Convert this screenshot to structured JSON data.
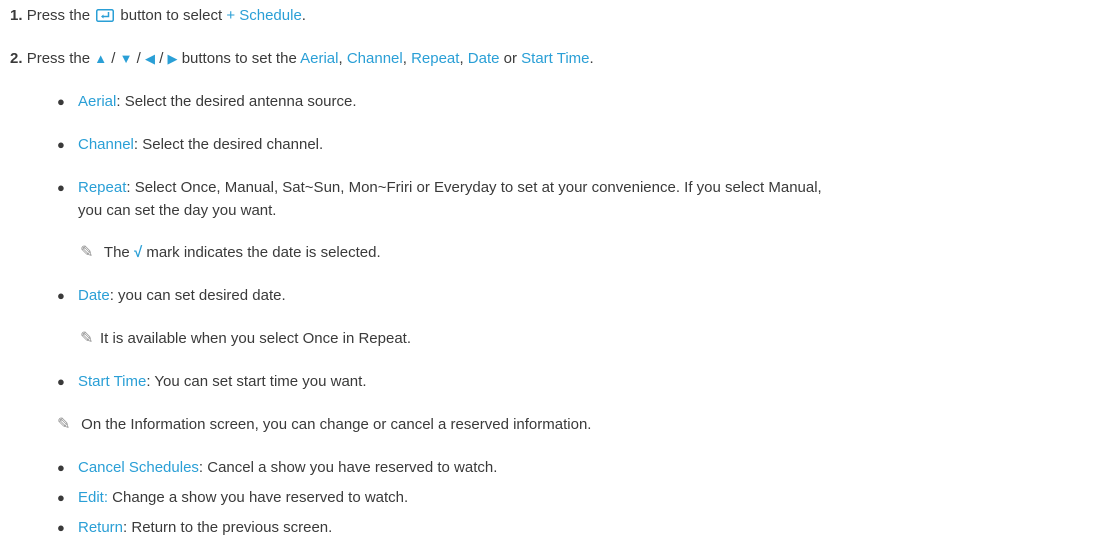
{
  "step1": {
    "number": "1.",
    "text_before": "Press the",
    "text_after": "button to select",
    "link": "+ Schedule",
    "end": ".",
    "enter_icon": "enter-button-icon"
  },
  "step2": {
    "number": "2.",
    "text_before": "Press the",
    "arrows": [
      "▲",
      "/",
      "▼",
      "/",
      "◀",
      "/",
      "▶"
    ],
    "text_after": "buttons to set the",
    "items": [
      "Aerial",
      "Channel",
      "Repeat",
      "Date",
      "Start Time"
    ],
    "sep1": ", ",
    "sep2": ", ",
    "sep3": ", ",
    "or": " or ",
    "end": "."
  },
  "bullets": [
    {
      "term": "Aerial",
      "desc": ": Select the desired antenna source."
    },
    {
      "term": "Channel",
      "desc": ": Select the desired channel."
    },
    {
      "term": "Repeat",
      "desc": ": Select Once, Manual, Sat~Sun, Mon~Friri or Everyday to set at your convenience. If you select Manual,",
      "desc2": "you can set the day you want."
    },
    {
      "term": "Date",
      "desc": ": you can set desired date."
    },
    {
      "term": "Start Time",
      "desc": ": You can set start time you want."
    },
    {
      "term": "Cancel Schedules",
      "desc": ": Cancel a show you have reserved to watch."
    },
    {
      "term": "Edit:",
      "desc": " Change a show you have reserved to watch."
    },
    {
      "term": "Return",
      "desc": ": Return to the previous screen."
    }
  ],
  "notes": {
    "check_note_before": "The",
    "check_mark": "√",
    "check_note_after": "mark indicates the date is selected.",
    "date_note": "It is available when you select Once in Repeat.",
    "info_note": "On the Information screen, you can change or cancel a reserved information."
  },
  "icons": {
    "note": "pencil-note-icon",
    "bullet": "bullet-dot"
  },
  "colors": {
    "accent": "#2a9fd6",
    "text": "#3a3a3a",
    "note_icon": "#8a8a8a"
  }
}
